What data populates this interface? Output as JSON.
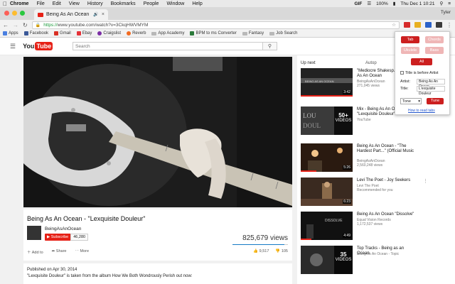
{
  "menubar": {
    "apple": "",
    "items": [
      "Chrome",
      "File",
      "Edit",
      "View",
      "History",
      "Bookmarks",
      "People",
      "Window",
      "Help"
    ],
    "gif": "GIF",
    "battery": "100%",
    "datetime": "Thu Dec 1  10:21"
  },
  "browser": {
    "tab_title": "Being As An Ocean - \"Lexqu",
    "user": "Tyler",
    "url_secure": "https://",
    "url_rest": "www.youtube.com/watch?v=3CkqHWVMYM"
  },
  "bookmarks": [
    {
      "label": "Apps",
      "color": "#4a7fe0"
    },
    {
      "label": "Facebook",
      "color": "#3b5998"
    },
    {
      "label": "Gmail",
      "color": "#d93025"
    },
    {
      "label": "Ebay",
      "color": "#e53238"
    },
    {
      "label": "Craigslist",
      "color": "#7b2ea5"
    },
    {
      "label": "Reverb",
      "color": "#f26b21"
    },
    {
      "label": "App Academy",
      "color": "folder"
    },
    {
      "label": "BPM to ms Converter",
      "color": "#2a7a3a"
    },
    {
      "label": "Fantasy",
      "color": "folder"
    },
    {
      "label": "Job Search",
      "color": "folder"
    }
  ],
  "youtube": {
    "logo_you": "You",
    "logo_tube": "Tube",
    "search_placeholder": "Search",
    "video_title": "Being As An Ocean - \"Lexquisite Douleur\"",
    "channel": "BeingAsAnOcean",
    "subscribe": "Subscribe",
    "subscriber_count": "46,280",
    "views": "825,679 views",
    "view_ratio": 0.93,
    "add_to": "Add to",
    "share": "Share",
    "more": "More",
    "likes": "9,517",
    "dislikes": "105",
    "published": "Published on Apr 30, 2014",
    "description": "\"Lexquisite Douleur\" is taken from the album How We Both Wondrously Perish out now:",
    "up_next": "Up next",
    "autoplay": "Autop"
  },
  "up_next": [
    {
      "title": "\"Mediocre Shakesp... Being As An Ocean",
      "channel": "BeingAsAnOcean",
      "meta": "271,045 views",
      "duration": "3:42",
      "playlist": false
    },
    {
      "title": "Mix - Being As An Ocean - \"Lexquisite Douleur\"",
      "channel": "YouTube",
      "meta": "",
      "duration": "",
      "playlist": true,
      "count": "50+",
      "count_label": "VIDEOS"
    },
    {
      "title": "Being As An Ocean - \"The Hardest Part...\" (Official Music",
      "channel": "BeingAsAnOcean",
      "meta": "2,560,248 views",
      "duration": "5:26",
      "playlist": false
    },
    {
      "title": "Levi The Poet - Joy Seekers",
      "channel": "Levi The Poet",
      "meta": "Recommended for you",
      "duration": "6:23",
      "playlist": false
    },
    {
      "title": "Being As An Ocean \"Dissolve\"",
      "channel": "Equal Vision Records",
      "meta": "1,172,537 views",
      "duration": "4:49",
      "playlist": false
    },
    {
      "title": "Top Tracks - Being as an Ocean",
      "channel": "Being As An Ocean - Topic",
      "meta": "",
      "duration": "",
      "playlist": true,
      "count": "35",
      "count_label": "VIDEOS"
    }
  ],
  "popup": {
    "tab": "Tab",
    "chords": "Chords",
    "ukulele": "Ukulele",
    "bass": "Bass",
    "all": "All",
    "title_before": "Title is before Artist",
    "artist_label": "Artist:",
    "artist_value": "Being As An Ocean",
    "title_label": "Title:",
    "title_value": "L'exquisite Douleur",
    "tone_select": "Tone",
    "tune": "Tune",
    "howto": "How to read tabs"
  }
}
